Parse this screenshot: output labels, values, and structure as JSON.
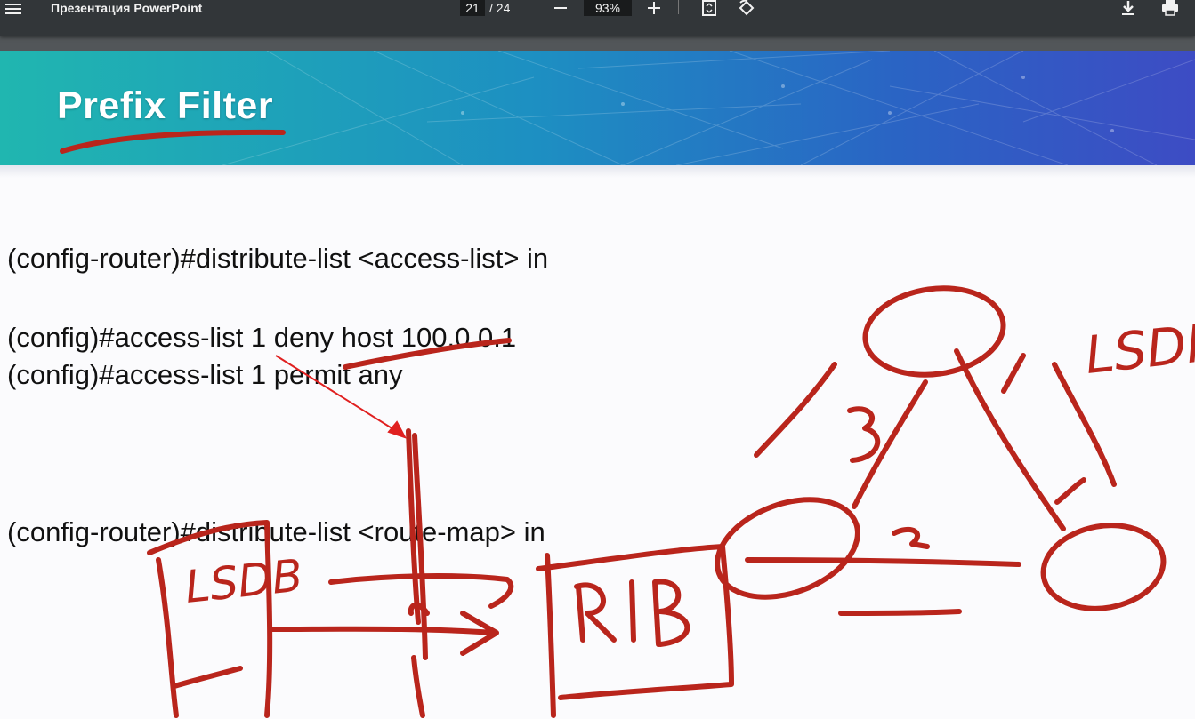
{
  "toolbar": {
    "title": "Презентация PowerPoint",
    "current_page": "21",
    "page_count": "/ 24",
    "zoom": "93%",
    "icons": [
      "menu-icon",
      "zoom-out-icon",
      "zoom-in-icon",
      "fit-page-icon",
      "rotate-icon",
      "download-icon",
      "print-icon"
    ]
  },
  "slide": {
    "title": "Prefix Filter",
    "lines": [
      "(config-router)#distribute-list <access-list> in",
      "(config)#access-list 1 deny host 100.0.0.1",
      "(config)#access-list 1 permit any",
      "(config-router)#distribute-list <route-map> in"
    ]
  },
  "annotations": {
    "lsdb_left": "LSDB",
    "rib": "RIB",
    "lsdb_right": "LSDI",
    "edge_3": "3",
    "edge_1": "1",
    "edge_2": "2",
    "edge_1b": "1",
    "ink_color": "#b9251c",
    "arrow_color": "#e02020"
  }
}
